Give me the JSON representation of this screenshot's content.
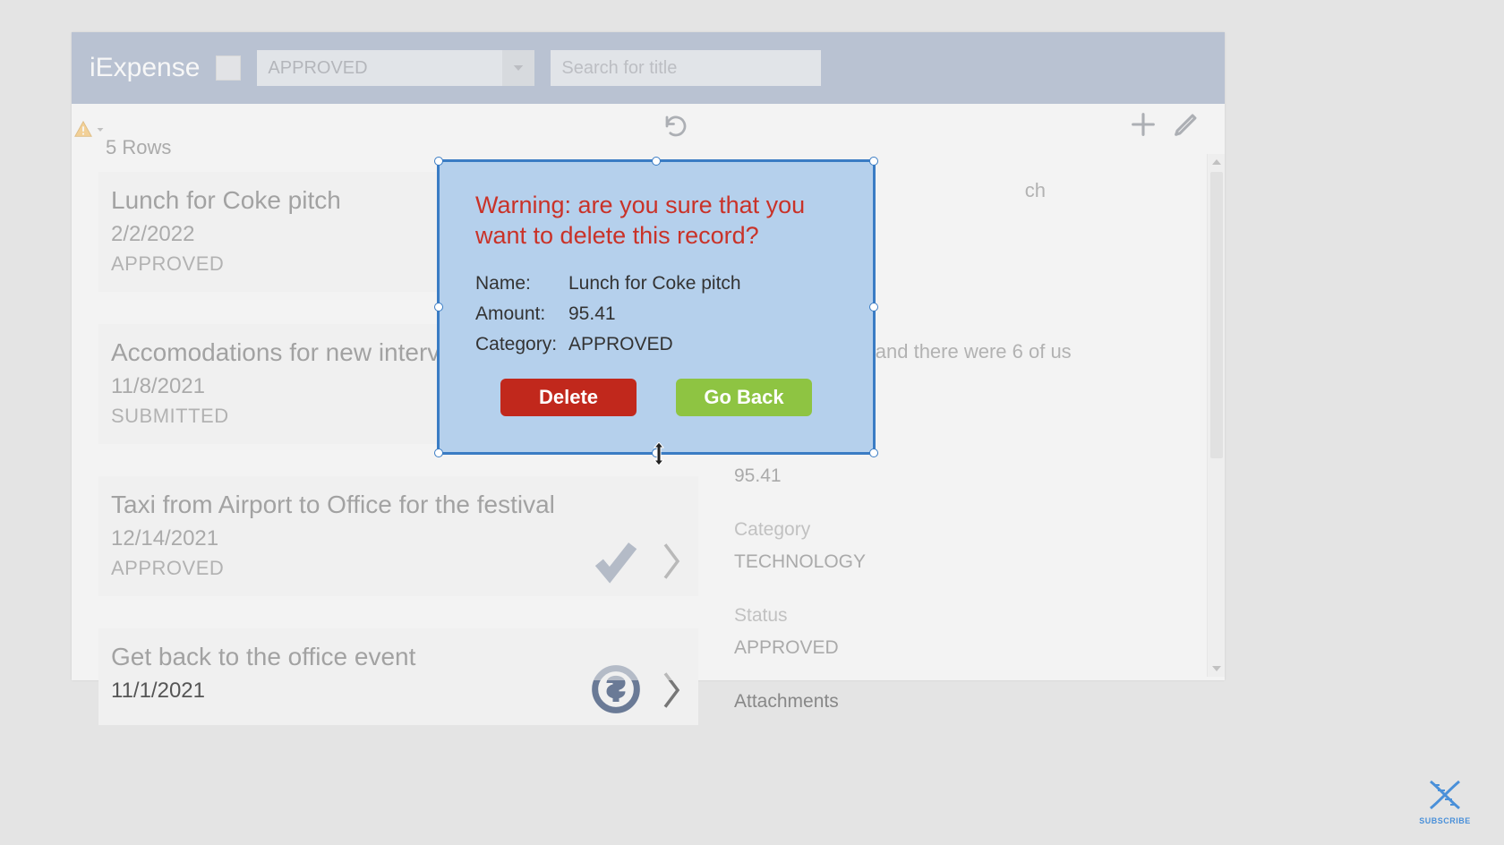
{
  "app_title": "iExpense",
  "filter": {
    "selected": "APPROVED"
  },
  "search": {
    "placeholder": "Search for title"
  },
  "rows_label": "5 Rows",
  "list": [
    {
      "title": "Lunch for Coke pitch",
      "date": "2/2/2022",
      "status": "APPROVED"
    },
    {
      "title": "Accomodations for new interv",
      "date": "11/8/2021",
      "status": "SUBMITTED"
    },
    {
      "title": "Taxi from Airport to Office for the festival",
      "date": "12/14/2021",
      "status": "APPROVED"
    },
    {
      "title": "Get back to the office event",
      "date": "11/1/2021",
      "status": ""
    }
  ],
  "detail": {
    "title_fragment": "ch",
    "desc_fragment": "potential clients and there were 6 of us",
    "amount": "95.41",
    "category_label": "Category",
    "category_value": "TECHNOLOGY",
    "status_label": "Status",
    "status_value": "APPROVED",
    "attachments_label": "Attachments"
  },
  "modal": {
    "title": "Warning: are you sure that you want to delete this record?",
    "name_label": "Name:",
    "name_value": "Lunch for Coke pitch",
    "amount_label": "Amount:",
    "amount_value": "95.41",
    "category_label": "Category:",
    "category_value": "APPROVED",
    "delete_label": "Delete",
    "goback_label": "Go Back"
  },
  "subscribe_label": "SUBSCRIBE"
}
